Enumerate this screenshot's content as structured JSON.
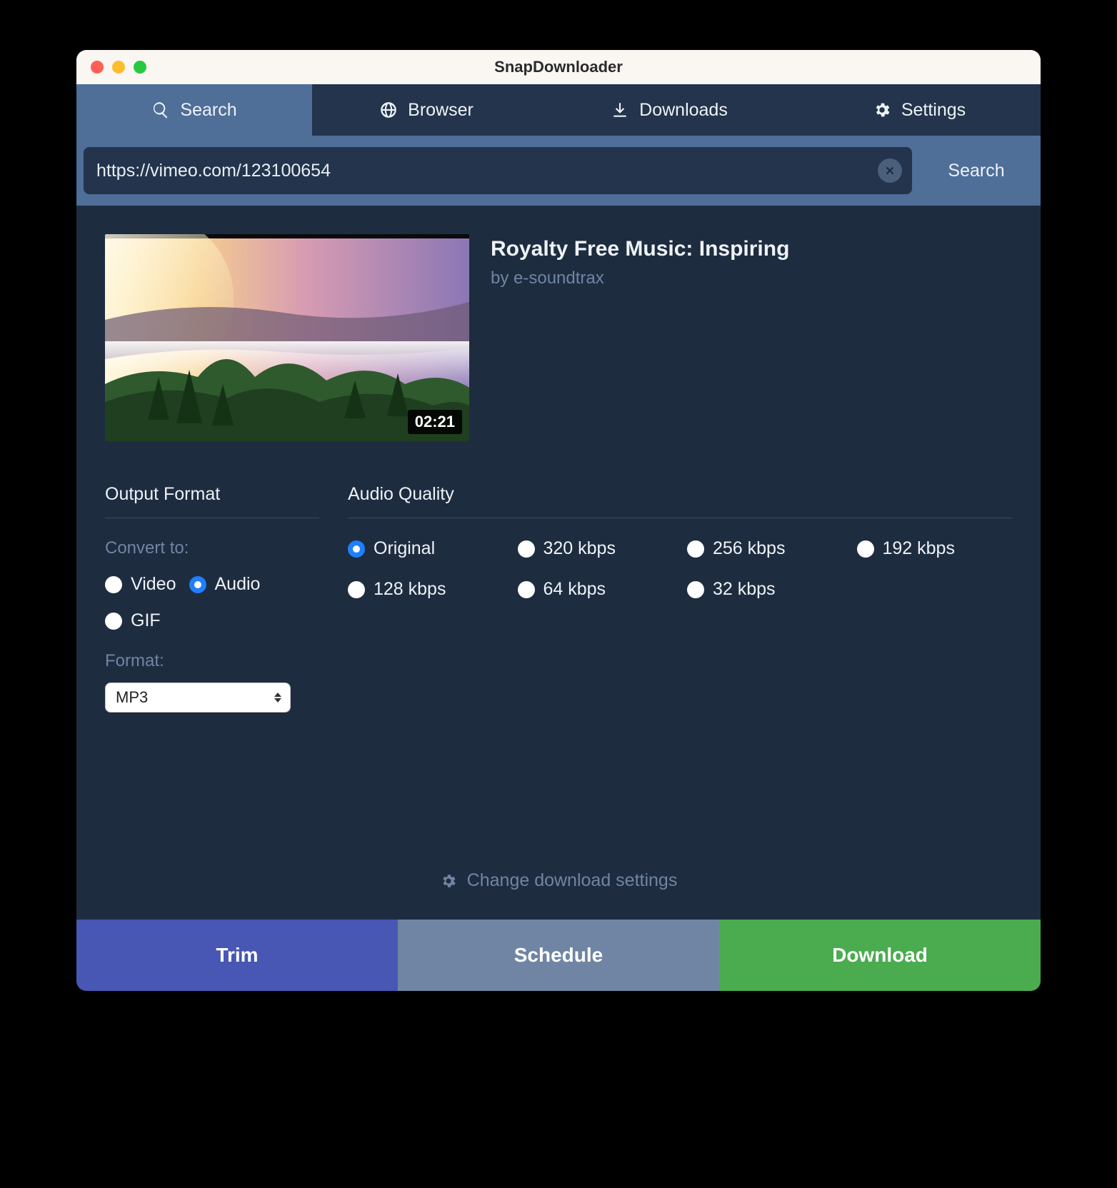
{
  "window": {
    "title": "SnapDownloader"
  },
  "tabs": {
    "search": "Search",
    "browser": "Browser",
    "downloads": "Downloads",
    "settings": "Settings",
    "active": "search"
  },
  "searchbar": {
    "url": "https://vimeo.com/123100654",
    "search_label": "Search"
  },
  "media": {
    "title": "Royalty Free Music: Inspiring",
    "author": "by e-soundtrax",
    "duration": "02:21"
  },
  "output_format": {
    "heading": "Output Format",
    "convert_label": "Convert to:",
    "options": [
      "Video",
      "Audio",
      "GIF"
    ],
    "selected": "Audio",
    "format_label": "Format:",
    "format_value": "MP3"
  },
  "audio_quality": {
    "heading": "Audio Quality",
    "options": [
      "Original",
      "320 kbps",
      "256 kbps",
      "192 kbps",
      "128 kbps",
      "64 kbps",
      "32 kbps"
    ],
    "selected": "Original"
  },
  "change_settings_label": "Change download settings",
  "actions": {
    "trim": "Trim",
    "schedule": "Schedule",
    "download": "Download"
  },
  "colors": {
    "accent_blue": "#4f6e98",
    "dark_bg": "#1e2c3f",
    "trim": "#4757b3",
    "schedule": "#6f85a3",
    "download": "#4aac4f"
  }
}
